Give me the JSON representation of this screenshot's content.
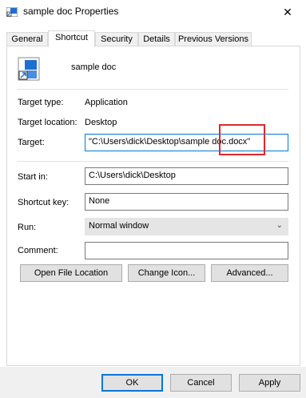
{
  "window": {
    "title": "sample doc Properties",
    "icon": "document-shortcut-icon",
    "close_glyph": "✕"
  },
  "tabs": [
    "General",
    "Shortcut",
    "Security",
    "Details",
    "Previous Versions"
  ],
  "active_tab": "Shortcut",
  "shortcut": {
    "name": "sample doc",
    "target_type_label": "Target type:",
    "target_type_value": "Application",
    "target_location_label": "Target location:",
    "target_location_value": "Desktop",
    "target_label": "Target:",
    "target_value": "\"C:\\Users\\dick\\Desktop\\sample doc.docx\"",
    "start_in_label": "Start in:",
    "start_in_value": "C:\\Users\\dick\\Desktop",
    "shortcut_key_label": "Shortcut key:",
    "shortcut_key_value": "None",
    "run_label": "Run:",
    "run_value": "Normal window",
    "comment_label": "Comment:",
    "comment_value": ""
  },
  "buttons": {
    "open_file_location": "Open File Location",
    "change_icon": "Change Icon...",
    "advanced": "Advanced..."
  },
  "footer": {
    "ok": "OK",
    "cancel": "Cancel",
    "apply": "Apply"
  },
  "colors": {
    "highlight": "#e0272b",
    "focus": "#0078d7"
  }
}
